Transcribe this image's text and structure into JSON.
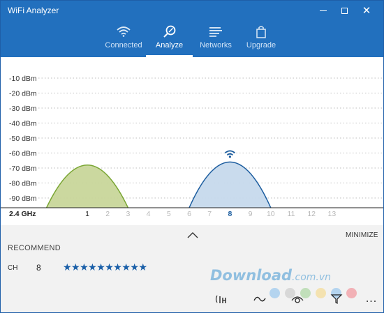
{
  "window": {
    "title": "WiFi Analyzer"
  },
  "nav": {
    "tabs": [
      {
        "label": "Connected",
        "icon": "wifi-icon"
      },
      {
        "label": "Analyze",
        "icon": "analyze-icon",
        "active": true
      },
      {
        "label": "Networks",
        "icon": "networks-icon"
      },
      {
        "label": "Upgrade",
        "icon": "bag-icon"
      }
    ]
  },
  "chart_data": {
    "type": "area",
    "band_label": "2.4 GHz",
    "y_ticks": [
      "-10 dBm",
      "-20 dBm",
      "-30 dBm",
      "-40 dBm",
      "-50 dBm",
      "-60 dBm",
      "-70 dBm",
      "-80 dBm",
      "-90 dBm"
    ],
    "ylim": [
      -100,
      -5
    ],
    "x_ticks": [
      "1",
      "2",
      "3",
      "4",
      "5",
      "6",
      "7",
      "8",
      "9",
      "10",
      "11",
      "12",
      "13"
    ],
    "highlight_channels": [
      "1",
      "8"
    ],
    "selected_channel": "8",
    "grid": true,
    "series": [
      {
        "channel_start": -1,
        "channel_end": 3,
        "center": 1,
        "peak_dbm": -68,
        "fill": "#c8d69a",
        "stroke": "#7aa634"
      },
      {
        "channel_start": 6,
        "channel_end": 10,
        "center": 8,
        "peak_dbm": -66,
        "fill": "#c6d9ec",
        "stroke": "#1c5d9f",
        "connected": true
      }
    ]
  },
  "panel": {
    "minimize_label": "MINIMIZE",
    "recommend_label": "RECOMMEND",
    "ch_label": "CH",
    "ch_value": "8",
    "rating": 10,
    "stars": "★★★★★★★★★★"
  },
  "watermark": {
    "text": "Download",
    "suffix": ".com.vn"
  },
  "toolbar": {
    "icons": [
      "signal-icon",
      "waveform-icon",
      "eye-icon",
      "filter-icon",
      "more-icon"
    ],
    "more_label": "..."
  },
  "colors": {
    "accent": "#2270be",
    "ch1_fill": "#c8d69a",
    "ch1_stroke": "#7aa634",
    "ch8_fill": "#c6d9ec",
    "ch8_stroke": "#1c5d9f",
    "dots": [
      "#a9cfee",
      "#d4d4d4",
      "#b9dcb0",
      "#f4dfa4",
      "#a9cfee",
      "#f2a6ac"
    ]
  }
}
